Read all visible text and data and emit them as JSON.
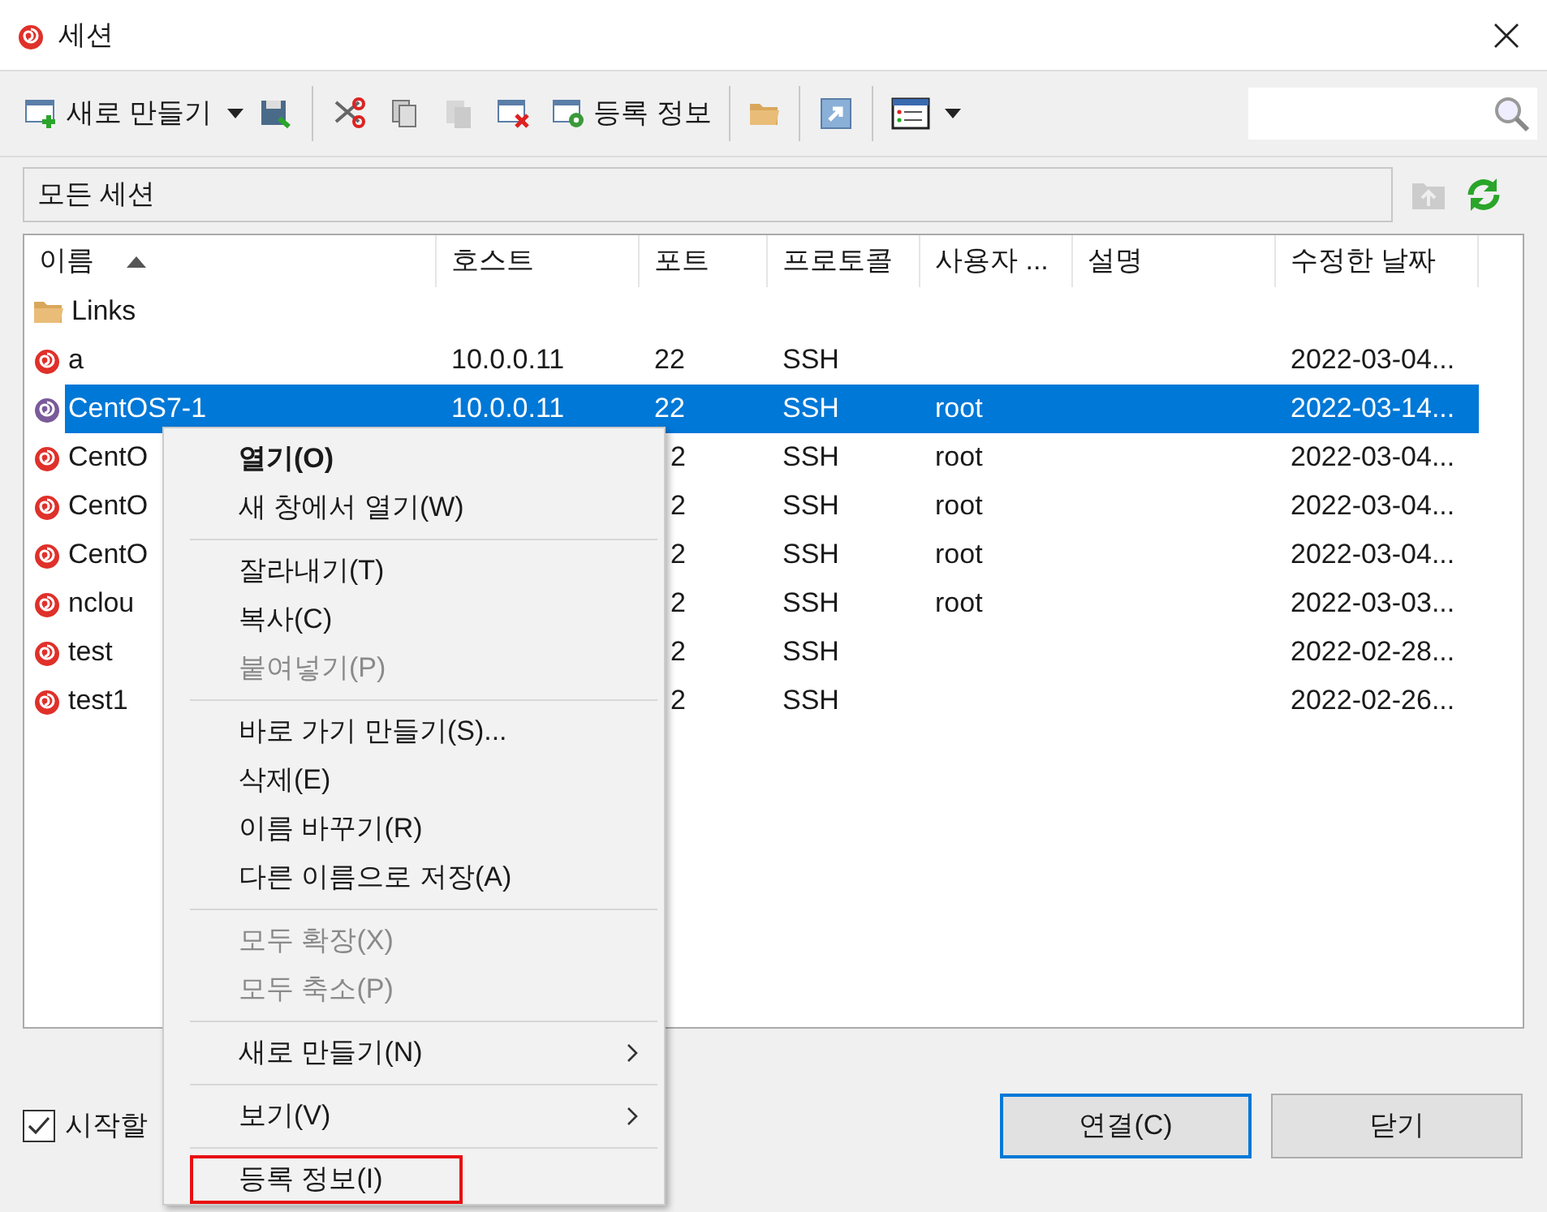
{
  "window": {
    "title": "세션"
  },
  "toolbar": [
    {
      "kind": "new",
      "label": "새로 만들기"
    },
    {
      "kind": "save"
    },
    {
      "kind": "cut"
    },
    {
      "kind": "copy"
    },
    {
      "kind": "paste",
      "disabled": true
    },
    {
      "kind": "delete"
    },
    {
      "kind": "properties",
      "label": "등록 정보"
    },
    {
      "kind": "folder"
    },
    {
      "kind": "shortcut"
    },
    {
      "kind": "view"
    }
  ],
  "filter": {
    "value": "모든 세션"
  },
  "table": {
    "columns": [
      {
        "label": "이름",
        "sorted": true
      },
      {
        "label": "호스트",
        "sorted": false
      },
      {
        "label": "포트",
        "sorted": false
      },
      {
        "label": "프로토콜",
        "sorted": false
      },
      {
        "label": "사용자 ...",
        "sorted": false
      },
      {
        "label": "설명",
        "sorted": false
      },
      {
        "label": "수정한 날짜",
        "sorted": false
      }
    ],
    "rows": [
      {
        "kind": "folder",
        "name": "Links",
        "selected": false
      },
      {
        "kind": "session",
        "color": "#e0302a",
        "name": "a",
        "host": "10.0.0.11",
        "port": "22",
        "protocol": "SSH",
        "date": "2022-03-04...",
        "selected": false
      },
      {
        "kind": "session",
        "color": "#7a5a9a",
        "name": "CentOS7-1",
        "host": "10.0.0.11",
        "port": "22",
        "protocol": "SSH",
        "user": "root",
        "date": "2022-03-14...",
        "selected": true
      },
      {
        "kind": "session",
        "color": "#e0302a",
        "name": "CentO",
        "port": "2",
        "protocol": "SSH",
        "user": "root",
        "date": "2022-03-04...",
        "selected": false
      },
      {
        "kind": "session",
        "color": "#e0302a",
        "name": "CentO",
        "port": "2",
        "protocol": "SSH",
        "user": "root",
        "date": "2022-03-04...",
        "selected": false
      },
      {
        "kind": "session",
        "color": "#e0302a",
        "name": "CentO",
        "port": "2",
        "protocol": "SSH",
        "user": "root",
        "date": "2022-03-04...",
        "selected": false
      },
      {
        "kind": "session",
        "color": "#e0302a",
        "name": "nclou",
        "port": "2",
        "protocol": "SSH",
        "user": "root",
        "date": "2022-03-03...",
        "selected": false
      },
      {
        "kind": "session",
        "color": "#e0302a",
        "name": "test",
        "port": "2",
        "protocol": "SSH",
        "date": "2022-02-28...",
        "selected": false
      },
      {
        "kind": "session",
        "color": "#e0302a",
        "name": "test1",
        "port": "2",
        "protocol": "SSH",
        "date": "2022-02-26...",
        "selected": false
      }
    ]
  },
  "startup_checkbox": {
    "label": "시작할",
    "checked": true
  },
  "buttons": [
    {
      "label": "연결(C)",
      "default": true
    },
    {
      "label": "닫기",
      "default": false
    }
  ],
  "context_menu": [
    {
      "kind": "item",
      "label": "열기(O)",
      "bold": true,
      "disabled": false
    },
    {
      "kind": "item",
      "label": "새 창에서 열기(W)",
      "disabled": false
    },
    {
      "kind": "separator"
    },
    {
      "kind": "item",
      "label": "잘라내기(T)",
      "disabled": false
    },
    {
      "kind": "item",
      "label": "복사(C)",
      "disabled": false
    },
    {
      "kind": "item",
      "label": "붙여넣기(P)",
      "disabled": true
    },
    {
      "kind": "separator"
    },
    {
      "kind": "item",
      "label": "바로 가기 만들기(S)...",
      "disabled": false
    },
    {
      "kind": "item",
      "label": "삭제(E)",
      "disabled": false
    },
    {
      "kind": "item",
      "label": "이름 바꾸기(R)",
      "disabled": false
    },
    {
      "kind": "item",
      "label": "다른 이름으로 저장(A)",
      "disabled": false
    },
    {
      "kind": "separator"
    },
    {
      "kind": "item",
      "label": "모두 확장(X)",
      "disabled": true
    },
    {
      "kind": "item",
      "label": "모두 축소(P)",
      "disabled": true
    },
    {
      "kind": "separator"
    },
    {
      "kind": "submenu",
      "label": "새로 만들기(N)",
      "disabled": false
    },
    {
      "kind": "separator"
    },
    {
      "kind": "submenu",
      "label": "보기(V)",
      "disabled": false
    },
    {
      "kind": "separator"
    },
    {
      "kind": "item",
      "label": "등록 정보(I)",
      "disabled": false,
      "outlined": true
    }
  ]
}
